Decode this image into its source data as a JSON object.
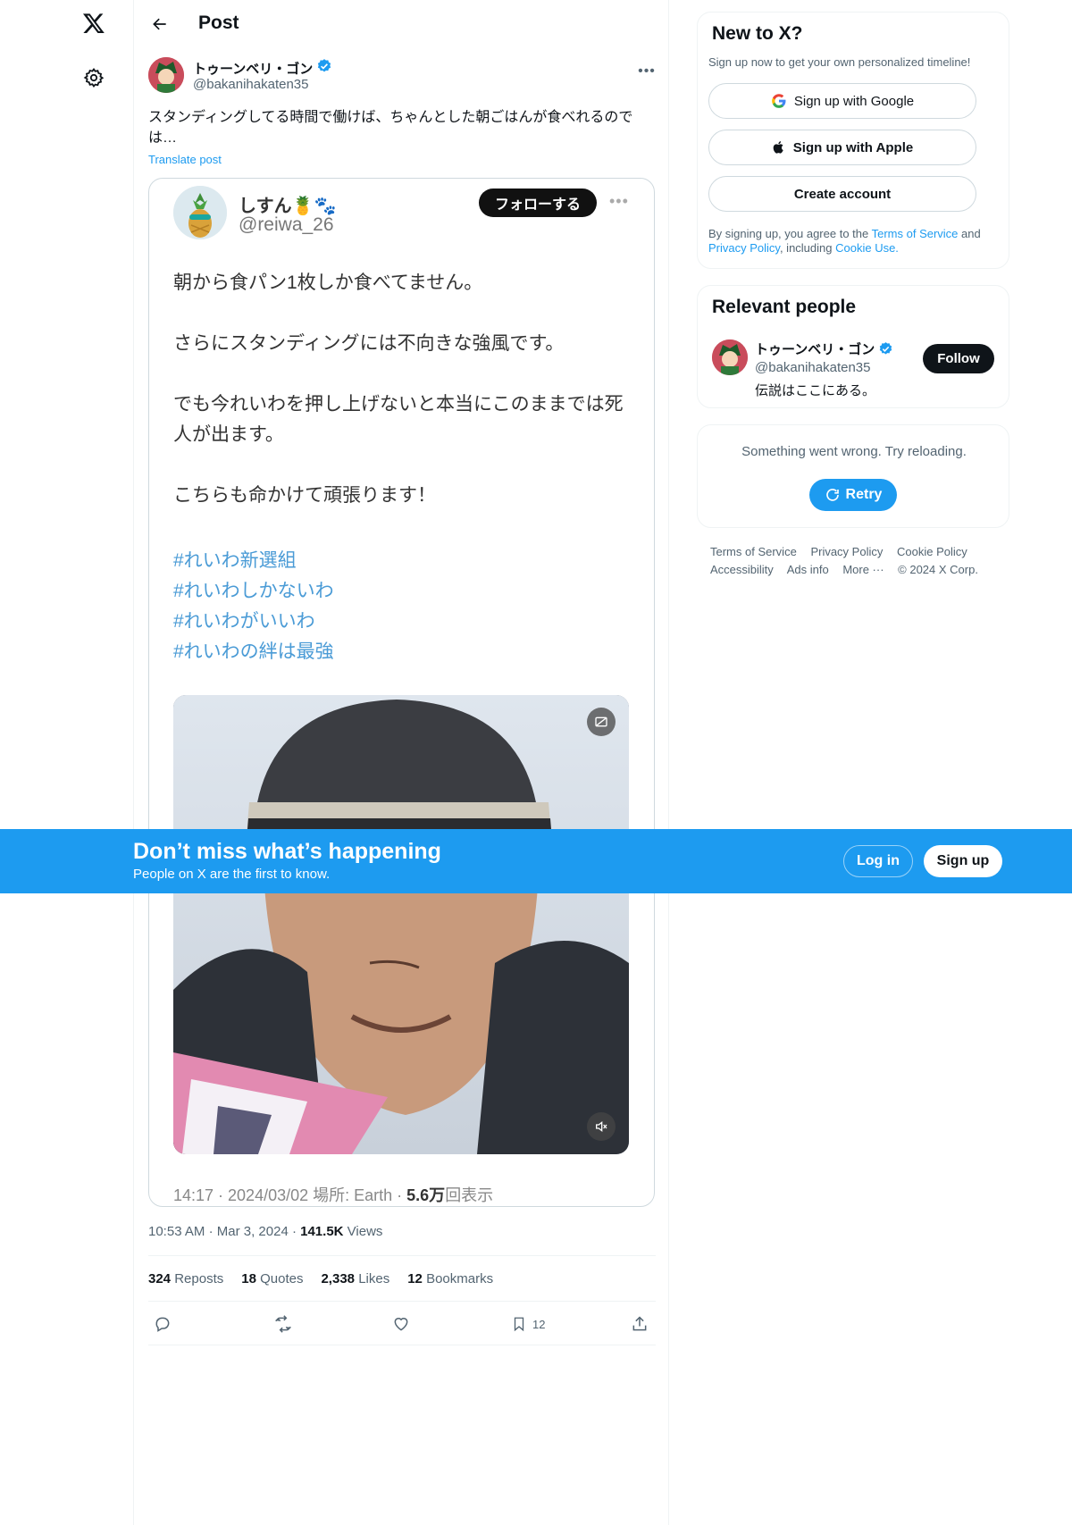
{
  "header": {
    "title": "Post"
  },
  "post": {
    "author_name": "トゥーンベリ・ゴン",
    "author_handle": "@bakanihakaten35",
    "text": "スタンディングしてる時間で働けば、ちゃんとした朝ごはんが食べれるのでは…",
    "translate_label": "Translate post",
    "time": "10:53 AM",
    "date": "Mar 3, 2024",
    "views_count": "141.5K",
    "views_label": "Views",
    "stats": [
      {
        "count": "324",
        "label": "Reposts"
      },
      {
        "count": "18",
        "label": "Quotes"
      },
      {
        "count": "2,338",
        "label": "Likes"
      },
      {
        "count": "12",
        "label": "Bookmarks"
      }
    ],
    "bookmark_count": "12"
  },
  "quoted": {
    "name": "しすん🍍🐾",
    "handle": "@reiwa_26",
    "follow_label": "フォローする",
    "paragraphs": [
      "朝から食パン1枚しか食べてません。",
      "さらにスタンディングには不向きな強風です。",
      "でも今れいわを押し上げないと本当にこのままでは死人が出ます。",
      "こちらも命かけて頑張ります！"
    ],
    "hashtags": [
      "#れいわ新選組",
      "#れいわしかないわ",
      "#れいわがいいわ",
      "#れいわの絆は最強"
    ],
    "meta_time": "14:17 · 2024/03/02 場所: Earth · ",
    "meta_views": "5.6万",
    "meta_views_label": "回表示"
  },
  "sidebar": {
    "new_to_x": {
      "title": "New to X?",
      "subtitle": "Sign up now to get your own personalized timeline!",
      "google_label": "Sign up with Google",
      "apple_label": "Sign up with Apple",
      "create_label": "Create account",
      "terms_prefix": "By signing up, you agree to the ",
      "terms_link": "Terms of Service",
      "terms_and": " and ",
      "privacy_link": "Privacy Policy",
      "including": ", including ",
      "cookie_link": "Cookie Use."
    },
    "relevant": {
      "title": "Relevant people",
      "name": "トゥーンベリ・ゴン",
      "handle": "@bakanihakaten35",
      "bio": "伝説はここにある。",
      "follow_label": "Follow"
    },
    "error": {
      "message": "Something went wrong. Try reloading.",
      "retry_label": "Retry"
    },
    "footer": {
      "links_row1": [
        "Terms of Service",
        "Privacy Policy",
        "Cookie Policy"
      ],
      "links_row2": [
        "Accessibility",
        "Ads info",
        "More ···",
        "© 2024 X Corp."
      ]
    }
  },
  "banner": {
    "title": "Don’t miss what’s happening",
    "subtitle": "People on X are the first to know.",
    "login_label": "Log in",
    "signup_label": "Sign up"
  },
  "colors": {
    "accent": "#1d9bf0",
    "text": "#0f1419",
    "muted": "#536471"
  }
}
